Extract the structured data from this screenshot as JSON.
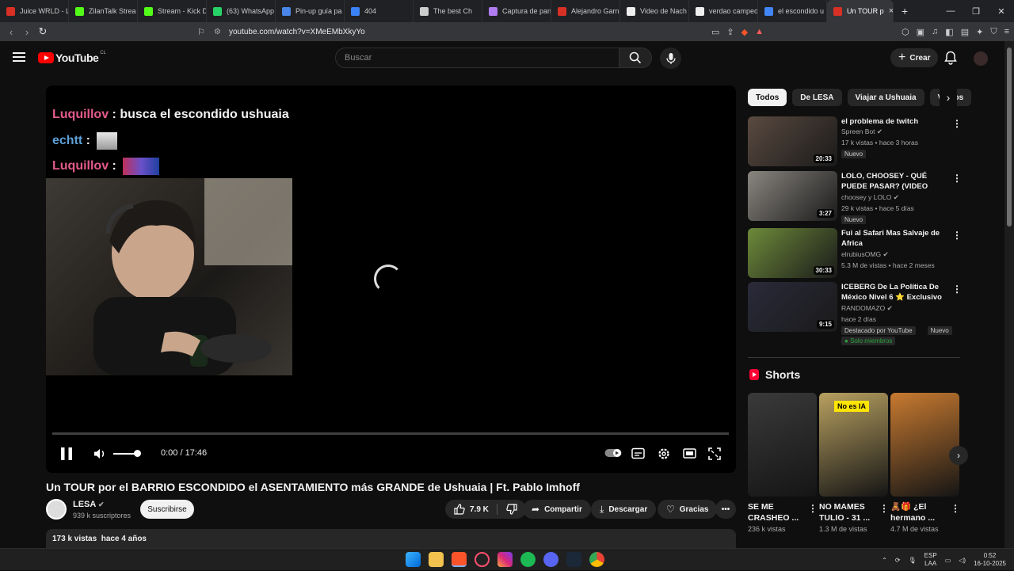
{
  "browser": {
    "tabs": [
      {
        "label": "Juice WRLD - L",
        "color": "#d93025"
      },
      {
        "label": "ZilanTalk Strea",
        "color": "#53fc18"
      },
      {
        "label": "Stream - Kick D",
        "color": "#53fc18"
      },
      {
        "label": "(63) WhatsApp",
        "color": "#25d366"
      },
      {
        "label": "Pin-up guía pa",
        "color": "#4a86e8"
      },
      {
        "label": "404",
        "color": "#3b82f6"
      },
      {
        "label": "The best Ch",
        "color": "#cccccc"
      },
      {
        "label": "Captura de pan",
        "color": "#b07cf0"
      },
      {
        "label": "Alejandro Garn",
        "color": "#d93025"
      },
      {
        "label": "Video de Nach",
        "color": "#eeeeee"
      },
      {
        "label": "verdao campeo",
        "color": "#eeeeee"
      },
      {
        "label": "el escondido u",
        "color": "#4285f4"
      },
      {
        "label": "Un TOUR p",
        "color": "#d93025"
      }
    ],
    "url": "youtube.com/watch?v=XMeEMbXkyYo"
  },
  "youtube": {
    "logo": "YouTube",
    "region": "CL",
    "search_placeholder": "Buscar",
    "create_label": "Crear"
  },
  "player": {
    "chat": [
      {
        "user": "Luquillov",
        "text": " : busca el escondido ushuaia"
      },
      {
        "user": "echtt",
        "text": " :"
      },
      {
        "user": "Luquillov",
        "text": " :"
      }
    ],
    "time": "0:00 / 17:46",
    "progress": 0
  },
  "video": {
    "title": "Un TOUR por el BARRIO ESCONDIDO el ASENTAMIENTO más GRANDE de Ushuaia | Ft. Pablo Imhoff",
    "channel": "LESA",
    "subscribers": "939 k suscriptores",
    "subscribe_label": "Suscribirse",
    "likes": "7.9 K",
    "share_label": "Compartir",
    "download_label": "Descargar",
    "thanks_label": "Gracias",
    "views": "173 k vistas",
    "age": "hace 4 años"
  },
  "chips": [
    "Todos",
    "De LESA",
    "Viajar a Ushuaia",
    "Videos"
  ],
  "recommendations": [
    {
      "title": "el problema de twitch",
      "channel": "Spreen Bot",
      "stats": "17 k vistas • hace 3 horas",
      "duration": "20:33",
      "badges": [
        "Nuevo"
      ],
      "thumb": "#5a4a40"
    },
    {
      "title": "LOLO, CHOOSEY - QUÉ PUEDE PASAR? (VIDEO OFICIAL)",
      "channel": "choosey y LOLO",
      "stats": "29 k vistas • hace 5 días",
      "duration": "3:27",
      "badges": [
        "Nuevo"
      ],
      "thumb": "#8a8680"
    },
    {
      "title": "Fui al Safari Mas Salvaje de Africa",
      "channel": "elrubiusOMG",
      "stats": "5.3 M de vistas • hace 2 meses",
      "duration": "30:33",
      "badges": [],
      "thumb": "#6d8a3a"
    },
    {
      "title": "ICEBERG De La Política De México Nivel 6 ⭐ Exclusivo ...",
      "channel": "RANDOMAZO",
      "stats": "hace 2 días",
      "duration": "9:15",
      "badges": [
        "Destacado por YouTube",
        "Nuevo"
      ],
      "members": "Solo miembros",
      "thumb": "#2a2a3a"
    }
  ],
  "shorts": {
    "heading": "Shorts",
    "items": [
      {
        "title": "SE ME CRASHEO ...",
        "views": "236 k vistas",
        "thumb": "#3a3a3a"
      },
      {
        "title": "NO MAMES TULIO - 31 ...",
        "views": "1.3 M de vistas",
        "thumb": "#b8a060",
        "overlay": "No es IA"
      },
      {
        "title": "🧸🎁 ¿El hermano ...",
        "views": "4.7 M de vistas",
        "thumb": "#c87a30"
      }
    ]
  },
  "taskbar": {
    "lang_top": "ESP",
    "lang_bottom": "LAA",
    "time": "0:52",
    "date": "16-10-2025"
  }
}
